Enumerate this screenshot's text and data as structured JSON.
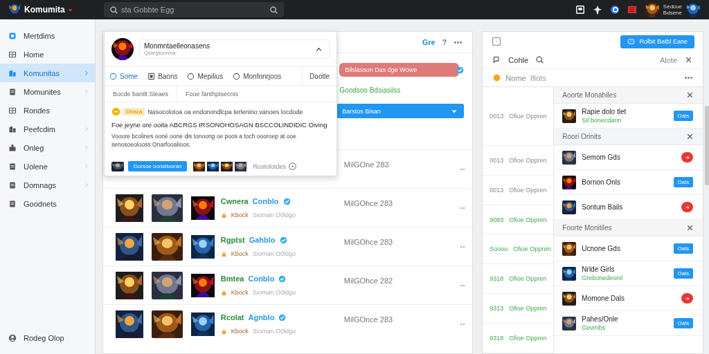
{
  "topbar": {
    "brand": "Komumita",
    "search": {
      "value": "sta Gobbte Egg"
    },
    "user_lines": [
      "Sedcue",
      "Bdsene"
    ]
  },
  "sidebar": {
    "items": [
      {
        "label": "Mertdims",
        "selected": false,
        "expandable": false
      },
      {
        "label": "Home",
        "selected": false,
        "expandable": false
      },
      {
        "label": "Komunitas",
        "selected": true,
        "expandable": true
      },
      {
        "label": "Momunites",
        "selected": false,
        "expandable": true
      },
      {
        "label": "Rondes",
        "selected": false,
        "expandable": false
      },
      {
        "label": "Peefcdim",
        "selected": false,
        "expandable": true
      },
      {
        "label": "Onleg",
        "selected": false,
        "expandable": true
      },
      {
        "label": "Uolene",
        "selected": false,
        "expandable": true
      },
      {
        "label": "Domnags",
        "selected": false,
        "expandable": true
      },
      {
        "label": "Goodnets",
        "selected": false,
        "expandable": false
      }
    ],
    "footer": "Rodeg Olop"
  },
  "main": {
    "header_actions": [
      "Gre",
      "?"
    ],
    "tags": [
      {
        "kind": "alert",
        "label": "Bilslasson Das dge Wowe"
      },
      {
        "kind": "status",
        "label": "Goodsoo Bdsiasilss"
      },
      {
        "kind": "dropdown",
        "label": "Barstos Bisan"
      }
    ],
    "rows": [
      {
        "reading": "MilGOne 283"
      },
      {
        "name": "Cwnera",
        "handle": "Conblo",
        "verified": true,
        "tag": "Kbock",
        "meta": "Sioman O0ldgo",
        "reading": "MilGOhce 283"
      },
      {
        "name": "Rgptst",
        "handle": "Gahblo",
        "verified": true,
        "tag": "Kbock",
        "meta": "Sioman O0ldgo",
        "reading": "MilGOhce 283"
      },
      {
        "name": "Bmtea",
        "handle": "Conblo",
        "verified": true,
        "tag": "Kbock",
        "meta": "Sioman O0ldgo",
        "reading": "MilGOhce 282"
      },
      {
        "name": "Rcolat",
        "handle": "Agnblo",
        "verified": true,
        "tag": "Kbock",
        "meta": "Sioman O0ldgo",
        "reading": "MilGOnce 283"
      }
    ]
  },
  "popup": {
    "title": "Monmntaelleonasens",
    "subtitle": "Qslegtoonna",
    "tabs": [
      {
        "label": "Some",
        "selected": true
      },
      {
        "label": "Baons",
        "selected": false
      },
      {
        "label": "Mepilius",
        "selected": false
      },
      {
        "label": "Monfonrjoos",
        "selected": false
      },
      {
        "label": "Dootle",
        "selected": false
      }
    ],
    "filters": [
      "Bocde bantlt Sleaes",
      "Fooe fanthptsecnis"
    ],
    "notice": {
      "badge": "Dhisra",
      "text": "Nasocolotoa oa endonondlcpa terlenino vanoes locdode"
    },
    "headline": "Foe jeyne ore ooita ABCRGS IRSONOHOSAGN BSCCOLINDIDIC Oiving",
    "body": "Vooore bcolines ooné oone dis tonoong oe poos a toch oooroep at ooe senosoeolooss Onarfooalioos.",
    "button": "Dorsoe oonsiluoran",
    "link": "Rustolotdes"
  },
  "right": {
    "button": "Rolbit Batbl Eane",
    "tool_label": "Cohle",
    "more_label": "Alote",
    "filter": {
      "label": "Nome",
      "value": "Ifiots"
    },
    "cells": [
      {
        "code": "0013",
        "text": "Ofioe Oppren",
        "active": false
      },
      {
        "code": "0013",
        "text": "Ofioe Oppren",
        "active": false
      },
      {
        "code": "0013",
        "text": "Ofioe Oppren",
        "active": false
      },
      {
        "code": "9083",
        "text": "Ofioe Oppren",
        "active": true
      },
      {
        "code": "Soooo",
        "text": "Ofioe Oppren",
        "active": true
      },
      {
        "code": "9318",
        "text": "Ofioe Oppren",
        "active": true
      },
      {
        "code": "9313",
        "text": "Ofioe Oppren",
        "active": true
      },
      {
        "code": "9318",
        "text": "Ofioe Oppren",
        "active": true
      }
    ],
    "groups": [
      {
        "title": "Aoorte Monahiles",
        "items": [
          {
            "name": "Rapie dolo tlet",
            "sub": "Sil bonecdarin",
            "kind": "add",
            "action": "Oats"
          }
        ]
      },
      {
        "title": "Roori Orinits",
        "items": [
          {
            "name": "Semom Gds",
            "kind": "remove"
          },
          {
            "name": "Bornon Onls",
            "kind": "add",
            "action": "Oats"
          },
          {
            "name": "Sontum Bails",
            "kind": "remove"
          }
        ]
      },
      {
        "title": "Foorte Monitiles",
        "items": [
          {
            "name": "Ucnone Gds",
            "kind": "add",
            "action": "Oats"
          },
          {
            "name": "Nrlde Girls",
            "sub": "Grebonedeonil",
            "kind": "add",
            "action": "Oats"
          },
          {
            "name": "Momone Dals",
            "kind": "remove"
          },
          {
            "name": "Pahes/Onle",
            "sub": "Gevrnbs",
            "kind": "add",
            "action": "Oats"
          }
        ]
      }
    ]
  }
}
